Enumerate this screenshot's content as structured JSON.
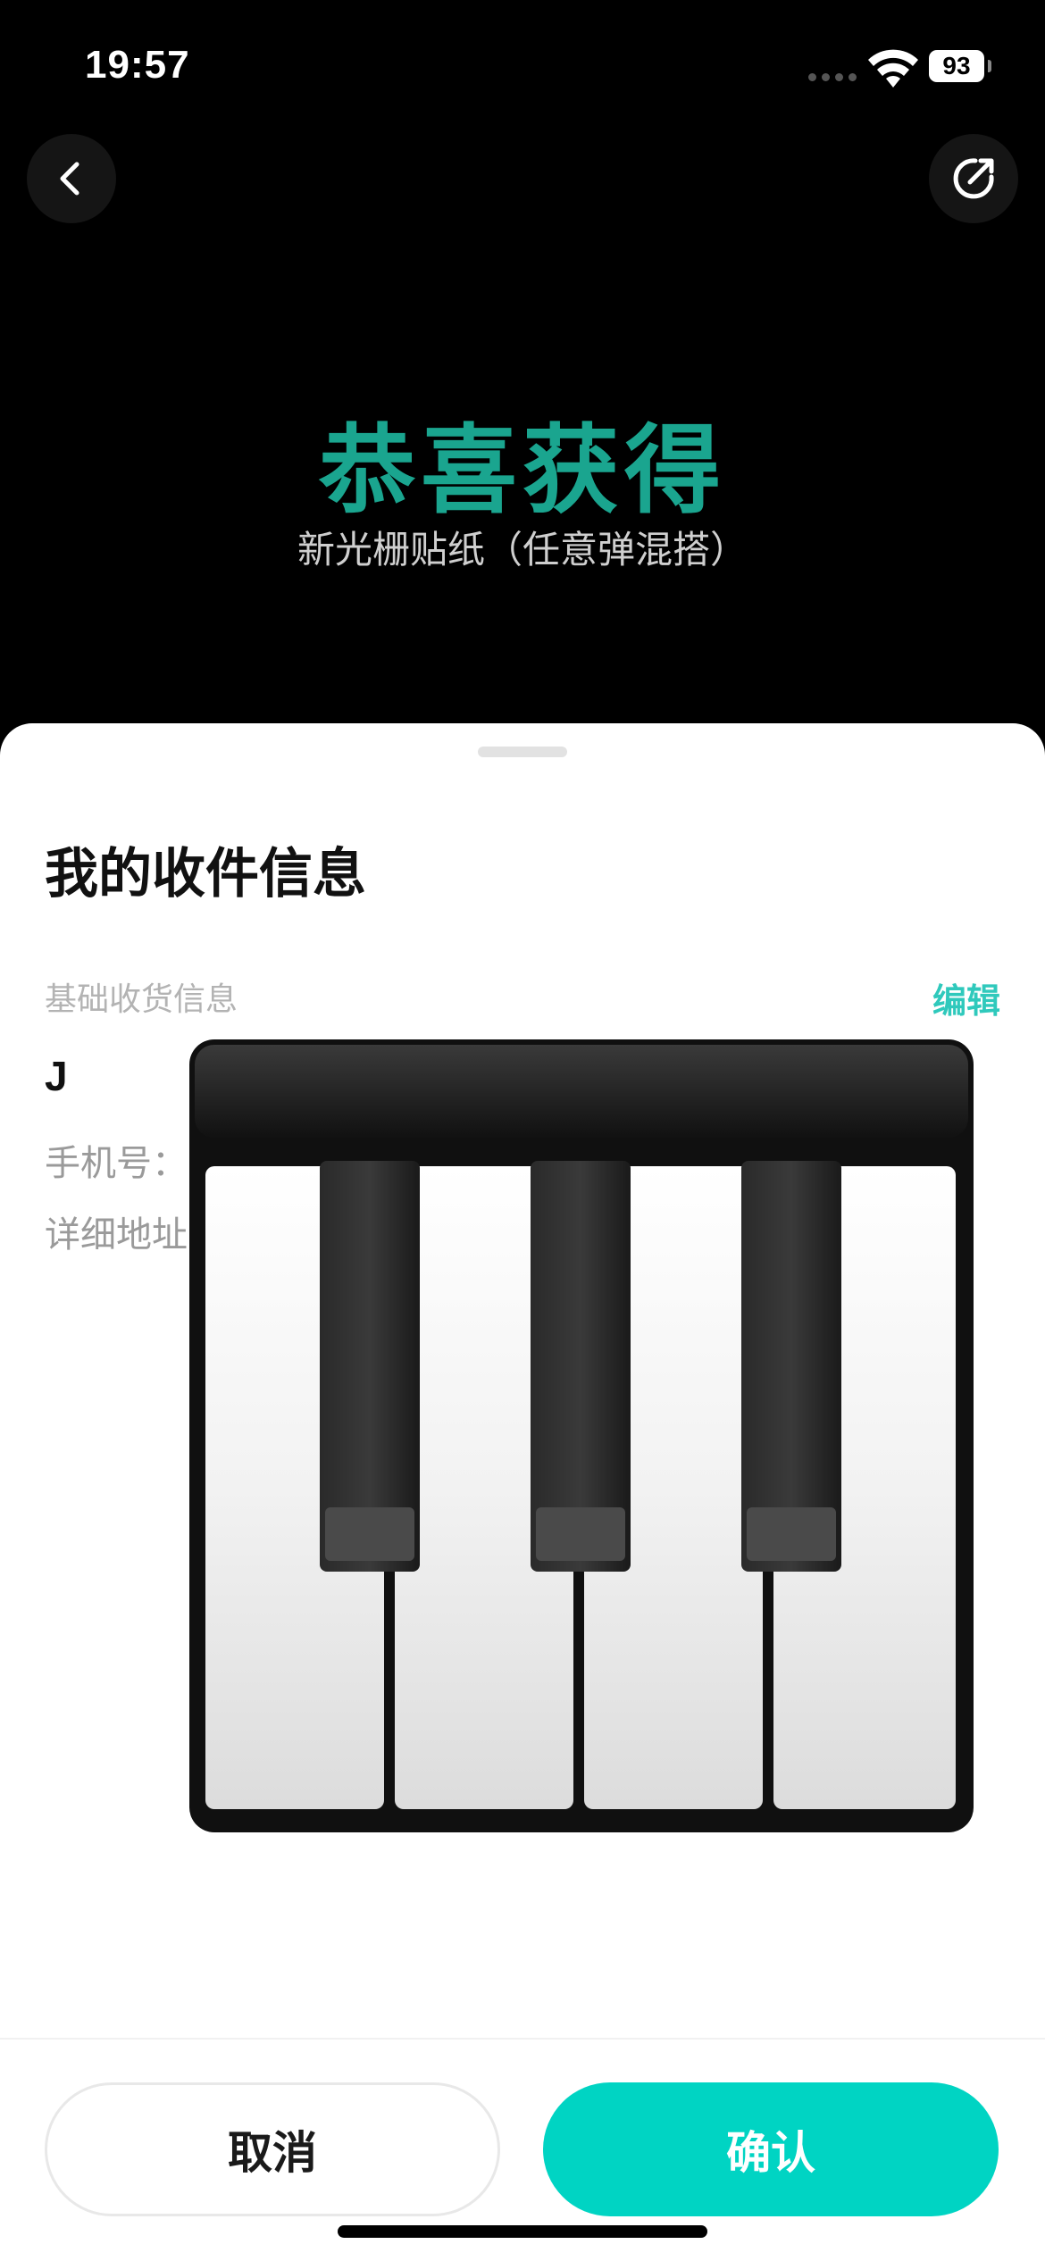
{
  "status": {
    "time": "19:57",
    "battery": "93"
  },
  "banner": {
    "title": "恭喜获得",
    "subtitle": "新光栅贴纸（任意弹混搭）"
  },
  "sheet": {
    "title": "我的收件信息",
    "section_label": "基础收货信息",
    "edit_label": "编辑",
    "recipient_name": "J",
    "phone_label": "手机号：",
    "address_label": "详细地址"
  },
  "buttons": {
    "cancel": "取消",
    "confirm": "确认"
  },
  "colors": {
    "accent": "#00d4c3",
    "title_green": "#1aa58f"
  },
  "icons": {
    "back": "chevron-left-icon",
    "share": "share-icon",
    "overlay": "piano-keyboard-icon"
  }
}
